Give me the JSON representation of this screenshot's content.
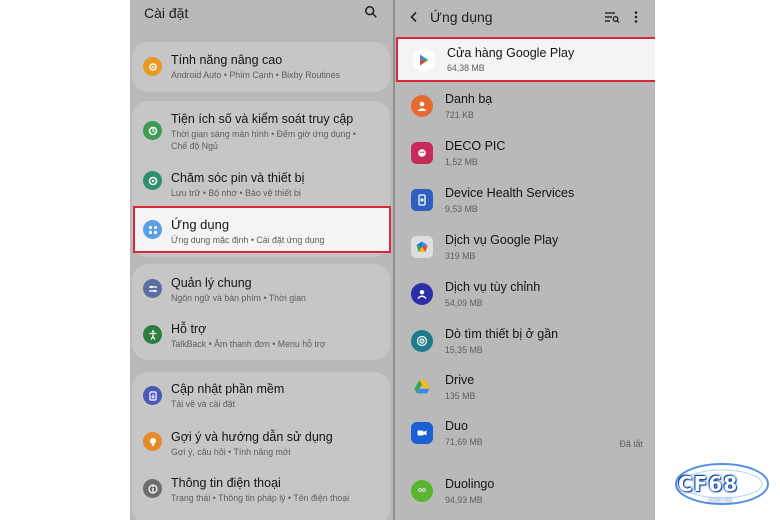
{
  "settings": {
    "title": "Cài đặt",
    "groups": [
      {
        "items": [
          {
            "title": "Tính năng nâng cao",
            "subtitle": "Android Auto • Phím Cạnh • Bixby Routines",
            "icon": "advanced-features-icon"
          }
        ]
      },
      {
        "items": [
          {
            "title": "Tiện ích số và kiểm soát truy cập",
            "subtitle": "Thời gian sáng màn hình • Đếm giờ ứng dụng •",
            "subtitle2": "Chế độ Ngủ",
            "icon": "digital-wellbeing-icon"
          },
          {
            "title": "Chăm sóc pin và thiết bị",
            "subtitle": "Lưu trữ • Bộ nhớ • Bảo vệ thiết bị",
            "icon": "device-care-icon"
          },
          {
            "title": "Ứng dụng",
            "subtitle": "Ứng dụng mặc định • Cài đặt ứng dụng",
            "icon": "apps-icon",
            "highlighted": true
          }
        ]
      },
      {
        "items": [
          {
            "title": "Quản lý chung",
            "subtitle": "Ngôn ngữ và bàn phím • Thời gian",
            "icon": "general-management-icon"
          },
          {
            "title": "Hỗ trợ",
            "subtitle": "TalkBack • Âm thanh đơn • Menu hỗ trợ",
            "icon": "accessibility-icon"
          }
        ]
      },
      {
        "items": [
          {
            "title": "Cập nhật phần mềm",
            "subtitle": "Tải về và cài đặt",
            "icon": "software-update-icon"
          },
          {
            "title": "Gợi ý và hướng dẫn sử dụng",
            "subtitle": "Gợi ý, câu hỏi • Tính năng mới",
            "icon": "tips-icon"
          },
          {
            "title": "Thông tin điện thoại",
            "subtitle": "Trạng thái • Thông tin pháp lý • Tên điện thoại",
            "icon": "about-phone-icon"
          }
        ]
      }
    ]
  },
  "apps": {
    "title": "Ứng dụng",
    "items": [
      {
        "name": "Cửa hàng Google Play",
        "size": "64,38 MB",
        "icon": "google-play-store-icon",
        "highlighted": true
      },
      {
        "name": "Danh bạ",
        "size": "721 KB",
        "icon": "contacts-icon"
      },
      {
        "name": "DECO PIC",
        "size": "1,52 MB",
        "icon": "deco-pic-icon"
      },
      {
        "name": "Device Health Services",
        "size": "9,53 MB",
        "icon": "device-health-icon"
      },
      {
        "name": "Dịch vụ Google Play",
        "size": "319 MB",
        "icon": "google-play-services-icon"
      },
      {
        "name": "Dịch vụ tùy chỉnh",
        "size": "54,09 MB",
        "icon": "customization-service-icon"
      },
      {
        "name": "Dò tìm thiết bị ở gần",
        "size": "15,35 MB",
        "icon": "nearby-device-scanning-icon"
      },
      {
        "name": "Drive",
        "size": "135 MB",
        "icon": "google-drive-icon"
      },
      {
        "name": "Duo",
        "size": "71,69 MB",
        "icon": "duo-icon",
        "status": "Đã tắt"
      },
      {
        "name": "Duolingo",
        "size": "94,93 MB",
        "icon": "duolingo-icon"
      }
    ]
  },
  "watermark": {
    "text": "CF68",
    "sub": "GAME BÀI"
  },
  "colors": {
    "highlight_border": "#d8283c",
    "screen_bg": "#b9b9b9",
    "card_bg": "#c6c6c6"
  }
}
